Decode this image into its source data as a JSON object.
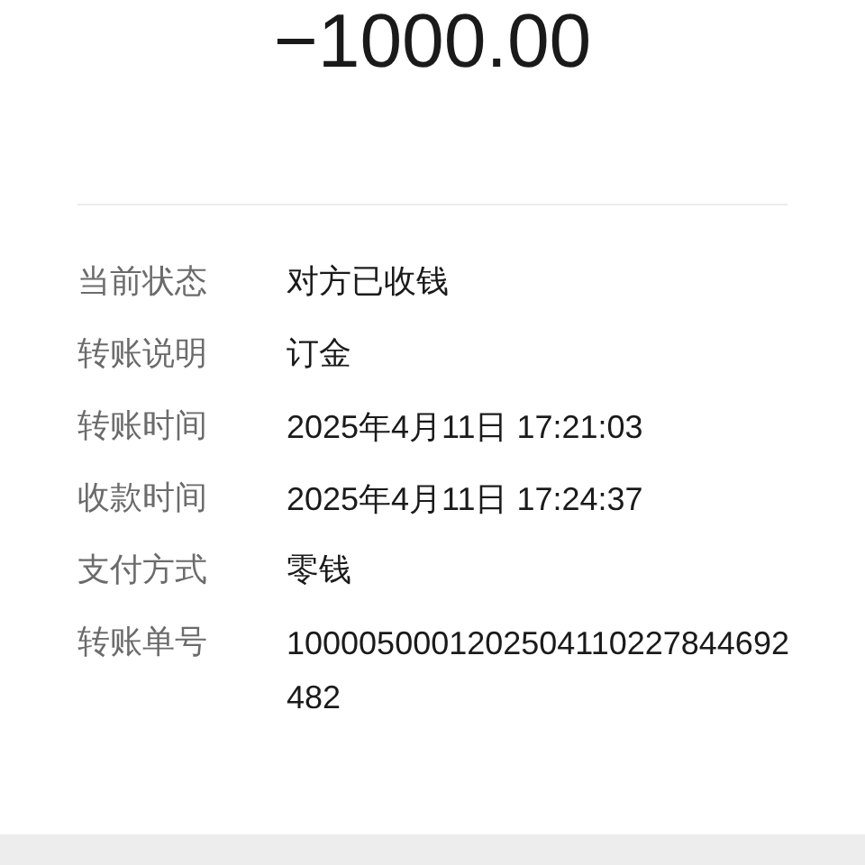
{
  "amount": "−1000.00",
  "details": [
    {
      "label": "当前状态",
      "value": "对方已收钱"
    },
    {
      "label": "转账说明",
      "value": "订金"
    },
    {
      "label": "转账时间",
      "value": "2025年4月11日 17:21:03"
    },
    {
      "label": "收款时间",
      "value": "2025年4月11日 17:24:37"
    },
    {
      "label": "支付方式",
      "value": "零钱"
    },
    {
      "label": "转账单号",
      "value": "1000050001202504110227844692482"
    }
  ]
}
